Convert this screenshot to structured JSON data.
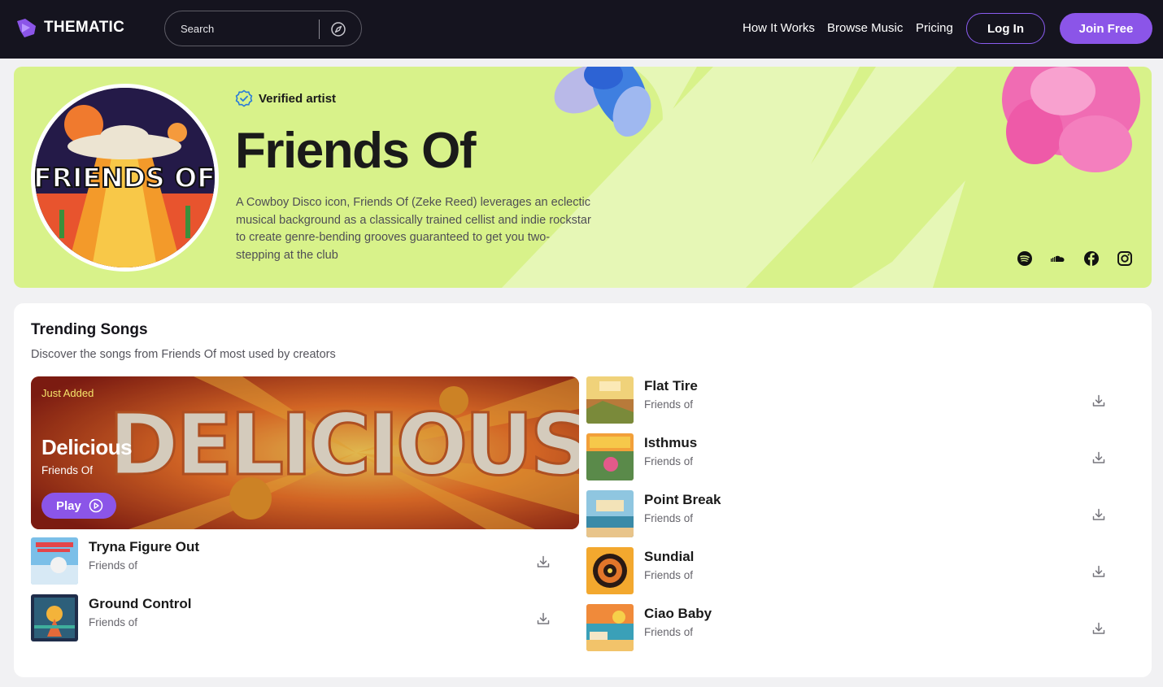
{
  "nav": {
    "logo_text": "THEMATIC",
    "search_placeholder": "Search",
    "links": [
      "How It Works",
      "Browse Music",
      "Pricing"
    ],
    "login_label": "Log In",
    "join_label": "Join Free"
  },
  "artist": {
    "verified_label": "Verified artist",
    "name": "Friends Of",
    "bio": "A Cowboy Disco icon, Friends Of (Zeke Reed) leverages an eclectic musical background as a classically trained cellist and indie rockstar to create genre-bending grooves guaranteed to get you two-stepping at the club",
    "avatar_text": "FRIENDS OF",
    "socials": [
      "spotify-icon",
      "soundcloud-icon",
      "facebook-icon",
      "instagram-icon"
    ]
  },
  "trending": {
    "title": "Trending Songs",
    "subtitle": "Discover the songs from Friends Of most used by creators",
    "featured": {
      "badge": "Just Added",
      "title": "Delicious",
      "artist": "Friends Of",
      "play_label": "Play",
      "art_text": "DELICIOUS"
    },
    "left_songs": [
      {
        "title": "Tryna Figure Out",
        "artist": "Friends of"
      },
      {
        "title": "Ground Control",
        "artist": "Friends of"
      }
    ],
    "right_songs": [
      {
        "title": "Flat Tire",
        "artist": "Friends of"
      },
      {
        "title": "Isthmus",
        "artist": "Friends of"
      },
      {
        "title": "Point Break",
        "artist": "Friends of"
      },
      {
        "title": "Sundial",
        "artist": "Friends of"
      },
      {
        "title": "Ciao Baby",
        "artist": "Friends of"
      }
    ]
  },
  "colors": {
    "nav_bg": "#15141f",
    "accent": "#8b55e8",
    "hero_bg": "#d8f28a",
    "badge_yellow": "#f6e56b"
  }
}
